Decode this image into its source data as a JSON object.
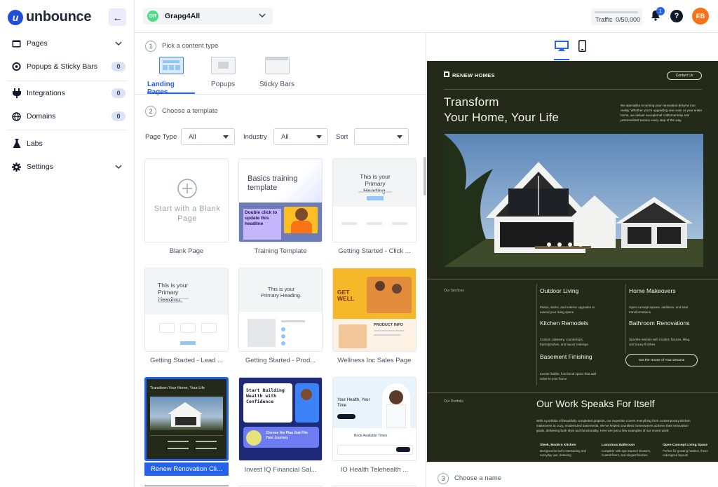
{
  "app": {
    "logo_text": "unbounce",
    "logo_mark": "u",
    "collapse_icon": "←"
  },
  "sidebar": {
    "items": [
      {
        "label": "Pages",
        "icon": "pages-icon",
        "chevron": "⌄"
      },
      {
        "label": "Popups & Sticky Bars",
        "icon": "popups-icon",
        "badge": "0"
      },
      {
        "label": "Integrations",
        "icon": "plug-icon",
        "badge": "0"
      },
      {
        "label": "Domains",
        "icon": "globe-icon",
        "badge": "0"
      },
      {
        "label": "Labs",
        "icon": "flask-icon"
      },
      {
        "label": "Settings",
        "icon": "gear-icon",
        "chevron": "⌄"
      }
    ]
  },
  "topbar": {
    "workspace": {
      "initials": "GR",
      "name": "Grapg4All"
    },
    "traffic": {
      "label": "Traffic",
      "value": "0/50,000"
    },
    "notifications_count": "1",
    "help": "?",
    "user_initials": "EB"
  },
  "steps": {
    "step1": {
      "num": "1",
      "label": "Pick a content type"
    },
    "step2": {
      "num": "2",
      "label": "Choose a template"
    },
    "step3": {
      "num": "3",
      "label": "Choose a name"
    }
  },
  "content_types": [
    {
      "label": "Landing Pages",
      "active": true
    },
    {
      "label": "Popups",
      "active": false
    },
    {
      "label": "Sticky Bars",
      "active": false
    }
  ],
  "filters": {
    "page_type": {
      "label": "Page Type",
      "value": "All"
    },
    "industry": {
      "label": "Industry",
      "value": "All"
    },
    "sort": {
      "label": "Sort",
      "value": ""
    }
  },
  "templates": [
    {
      "title": "Blank Page",
      "thumb_text": "Start with a Blank Page"
    },
    {
      "title": "Training Template",
      "thumb_text": "Basics training template",
      "thumb_sub": "Double click to update this headline"
    },
    {
      "title": "Getting Started - Click ...",
      "thumb_text": "This is your Primary Heading."
    },
    {
      "title": "Getting Started - Lead ...",
      "thumb_text": "This is your Primary Heading."
    },
    {
      "title": "Getting Started - Prod...",
      "thumb_text": "This is your Primary Heading."
    },
    {
      "title": "Wellness Inc Sales Page",
      "thumb_text": "GET WELL",
      "thumb_sub": "PRODUCT INFO"
    },
    {
      "title": "Renew Renovation Cli...",
      "thumb_text": "Transform Your Home, Your Life",
      "selected": true
    },
    {
      "title": "Invest IQ Financial Sal...",
      "thumb_text": "Start Building Wealth with Confidence",
      "thumb_sub": "Choose the Plan that Fits Your Journey"
    },
    {
      "title": "IO Health Telehealth ...",
      "thumb_text": "Your Health, Your Time",
      "thumb_sub": "Book Available Times"
    }
  ],
  "preview": {
    "brand": "RENEW HOMES",
    "contact_button": "Contact Us",
    "hero_line1": "Transform",
    "hero_line2": "Your Home, Your Life",
    "intro": "We specialize in turning your renovation dreams into reality. Whether you're upgrading one room or your entire home, we deliver exceptional craftsmanship and personalized service every step of the way.",
    "services_label": "Our Services",
    "services": [
      {
        "title": "Outdoor Living",
        "desc": "Patios, decks, and exterior upgrades to extend your living space"
      },
      {
        "title": "Home Makeovers",
        "desc": "Open-concept spaces, additions, and total transformations"
      },
      {
        "title": "Kitchen Remodels",
        "desc": "Custom cabinetry, countertops, backsplashes, and layout redesign"
      },
      {
        "title": "Bathroom Renovations",
        "desc": "Spa-like retreats with modern fixtures, tiling, and luxury finishes"
      },
      {
        "title": "Basement Finishing",
        "desc": "Create livable, functional space that add value to your home"
      }
    ],
    "cta": "Get the House of Your Dreams",
    "portfolio_label": "Our Portfolio",
    "work_title": "Our Work Speaks For Itself",
    "work_desc": "With a portfolio of beautifully completed projects, our expertise covers everything from contemporary kitchen makeovers to cozy, modernized basements. We've helped countless homeowners achieve their renovation goals, delivering both style and functionality. Here are just a few examples of our recent work:",
    "portfolio": [
      {
        "title": "Sleek, Modern Kitchen",
        "desc": "Designed for both entertaining and everyday use, featuring"
      },
      {
        "title": "Luxurious Bathroom",
        "desc": "Complete with spa-inspired showers, heated floors, and elegant finishes."
      },
      {
        "title": "Open-Concept Living Space",
        "desc": "Perfect for growing families, these redesigned layouts"
      }
    ]
  },
  "colors": {
    "accent": "#2563eb",
    "preview_bg": "#232a1a",
    "avatar": "#f97316"
  }
}
